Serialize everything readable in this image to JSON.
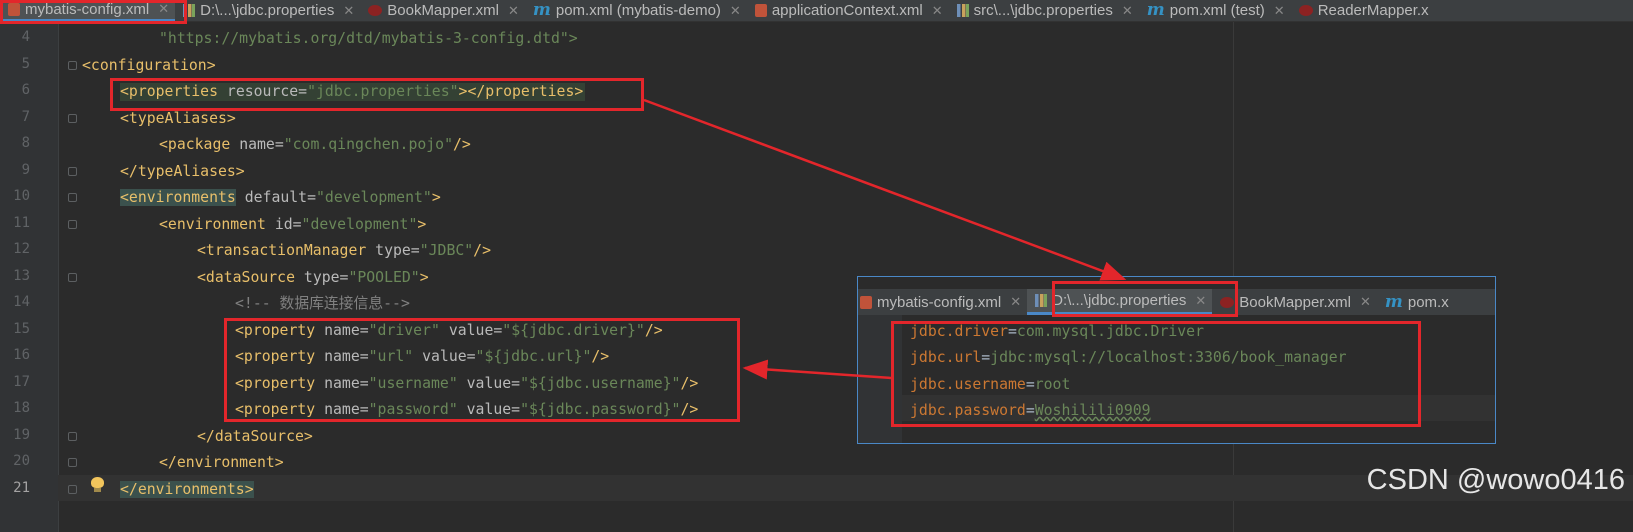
{
  "tabs": [
    {
      "label": "mybatis-config.xml",
      "icon": "xml-file-icon",
      "active": true
    },
    {
      "label": "D:\\...\\jdbc.properties",
      "icon": "properties-file-icon"
    },
    {
      "label": "BookMapper.xml",
      "icon": "mapper-file-icon"
    },
    {
      "label": "pom.xml (mybatis-demo)",
      "icon": "maven-icon"
    },
    {
      "label": "applicationContext.xml",
      "icon": "xml-file-icon"
    },
    {
      "label": "src\\...\\jdbc.properties",
      "icon": "properties-file-icon"
    },
    {
      "label": "pom.xml (test)",
      "icon": "maven-icon"
    },
    {
      "label": "ReaderMapper.x",
      "icon": "mapper-file-icon"
    }
  ],
  "line_numbers": [
    "4",
    "5",
    "6",
    "7",
    "8",
    "9",
    "10",
    "11",
    "12",
    "13",
    "14",
    "15",
    "16",
    "17",
    "18",
    "19",
    "20",
    "21"
  ],
  "code": {
    "dtd_url": "\"https://mybatis.org/dtd/mybatis-3-config.dtd\">",
    "configuration_open": "<configuration>",
    "properties_tag": "<properties",
    "properties_attr": " resource=",
    "properties_value": "\"jdbc.properties\"",
    "properties_close": "></properties>",
    "typealiases_open": "<typeAliases>",
    "package_tag": "<package",
    "package_attr": " name=",
    "package_value": "\"com.qingchen.pojo\"",
    "package_close": "/>",
    "typealiases_close": "</typeAliases>",
    "environments_tag": "<environments",
    "environments_attr": " default=",
    "environments_value": "\"development\"",
    "environments_gt": ">",
    "environment_tag": "<environment",
    "environment_attr": " id=",
    "environment_value": "\"development\"",
    "environment_gt": ">",
    "tm_tag": "<transactionManager",
    "tm_attr": " type=",
    "tm_value": "\"JDBC\"",
    "tm_close": "/>",
    "ds_tag": "<dataSource",
    "ds_attr": " type=",
    "ds_value": "\"POOLED\"",
    "ds_gt": ">",
    "comment": "<!-- 数据库连接信息-->",
    "props": [
      {
        "tag": "<property",
        "name_attr": " name=",
        "name": "\"driver\"",
        "value_attr": " value=",
        "value": "\"${jdbc.driver}\"",
        "close": "/>"
      },
      {
        "tag": "<property",
        "name_attr": " name=",
        "name": "\"url\"",
        "value_attr": " value=",
        "value": "\"${jdbc.url}\"",
        "close": "/>"
      },
      {
        "tag": "<property",
        "name_attr": " name=",
        "name": "\"username\"",
        "value_attr": " value=",
        "value": "\"${jdbc.username}\"",
        "close": "/>"
      },
      {
        "tag": "<property",
        "name_attr": " name=",
        "name": "\"password\"",
        "value_attr": " value=",
        "value": "\"${jdbc.password}\"",
        "close": "/>"
      }
    ],
    "ds_close": "</dataSource>",
    "environment_close": "</environment>",
    "environments_close": "</environments>"
  },
  "popup": {
    "tabs": [
      {
        "label": "mybatis-config.xml",
        "icon": "xml-file-icon"
      },
      {
        "label": "D:\\...\\jdbc.properties",
        "icon": "properties-file-icon",
        "active": true
      },
      {
        "label": "BookMapper.xml",
        "icon": "mapper-file-icon"
      },
      {
        "label": "pom.x",
        "icon": "maven-icon"
      }
    ],
    "lines": [
      {
        "key": "jdbc.driver",
        "eq": "=",
        "value": "com.mysql.jdbc.Driver"
      },
      {
        "key": "jdbc.url",
        "eq": "=",
        "value": "jdbc:mysql://localhost:3306/book_manager"
      },
      {
        "key": "jdbc.username",
        "eq": "=",
        "value": "root"
      },
      {
        "key": "jdbc.password",
        "eq": "=",
        "value": "Woshilili0909"
      }
    ]
  },
  "watermark": "CSDN @wowo0416",
  "colors": {
    "annotation_red": "#e3262b",
    "tag": "#e8bf6a",
    "string": "#6a8759",
    "editor_bg": "#2b2b2b"
  }
}
